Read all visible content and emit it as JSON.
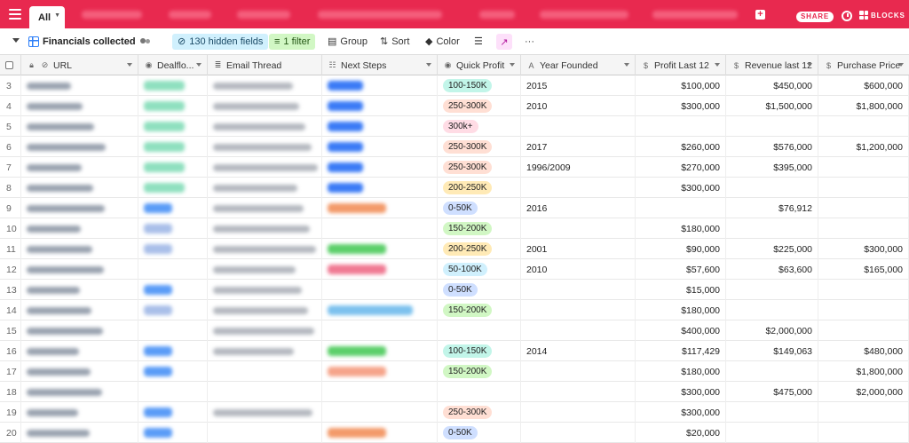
{
  "app": {
    "view_tab": "All",
    "share": "SHARE",
    "blocks": "BLOCKS"
  },
  "toolbar": {
    "view_name": "Financials collected",
    "hidden_fields": "130 hidden fields",
    "filter": "1 filter",
    "group": "Group",
    "sort": "Sort",
    "color": "Color",
    "more": "···"
  },
  "columns": [
    "URL",
    "Dealflo...",
    "Email Thread",
    "Next Steps",
    "Quick Profit",
    "Year Founded",
    "Profit Last 12",
    "Revenue last 12",
    "Purchase Price"
  ],
  "colors": {
    "brand": "#e8294f",
    "accent": "#2d7ff9"
  },
  "rows": [
    {
      "n": "3",
      "quick": "100-150K",
      "qc": "#c2f5e9",
      "year": "2015",
      "profit": "$100,000",
      "revenue": "$450,000",
      "price": "$600,000"
    },
    {
      "n": "4",
      "quick": "250-300K",
      "qc": "#ffdfd4",
      "year": "2010",
      "profit": "$300,000",
      "revenue": "$1,500,000",
      "price": "$1,800,000"
    },
    {
      "n": "5",
      "quick": "300k+",
      "qc": "#ffdce5",
      "year": "",
      "profit": "",
      "revenue": "",
      "price": ""
    },
    {
      "n": "6",
      "quick": "250-300K",
      "qc": "#ffdfd4",
      "year": "2017",
      "profit": "$260,000",
      "revenue": "$576,000",
      "price": "$1,200,000"
    },
    {
      "n": "7",
      "quick": "250-300K",
      "qc": "#ffdfd4",
      "year": "1996/2009",
      "profit": "$270,000",
      "revenue": "$395,000",
      "price": ""
    },
    {
      "n": "8",
      "quick": "200-250K",
      "qc": "#ffeab6",
      "year": "",
      "profit": "$300,000",
      "revenue": "",
      "price": ""
    },
    {
      "n": "9",
      "quick": "0-50K",
      "qc": "#cfdfff",
      "year": "2016",
      "profit": "",
      "revenue": "$76,912",
      "price": ""
    },
    {
      "n": "10",
      "quick": "150-200K",
      "qc": "#d1f7c4",
      "year": "",
      "profit": "$180,000",
      "revenue": "",
      "price": ""
    },
    {
      "n": "11",
      "quick": "200-250K",
      "qc": "#ffeab6",
      "year": "2001",
      "profit": "$90,000",
      "revenue": "$225,000",
      "price": "$300,000"
    },
    {
      "n": "12",
      "quick": "50-100K",
      "qc": "#d0f0fd",
      "year": "2010",
      "profit": "$57,600",
      "revenue": "$63,600",
      "price": "$165,000"
    },
    {
      "n": "13",
      "quick": "0-50K",
      "qc": "#cfdfff",
      "year": "",
      "profit": "$15,000",
      "revenue": "",
      "price": ""
    },
    {
      "n": "14",
      "quick": "150-200K",
      "qc": "#d1f7c4",
      "year": "",
      "profit": "$180,000",
      "revenue": "",
      "price": ""
    },
    {
      "n": "15",
      "quick": "",
      "qc": "",
      "year": "",
      "profit": "$400,000",
      "revenue": "$2,000,000",
      "price": ""
    },
    {
      "n": "16",
      "quick": "100-150K",
      "qc": "#c2f5e9",
      "year": "2014",
      "profit": "$117,429",
      "revenue": "$149,063",
      "price": "$480,000"
    },
    {
      "n": "17",
      "quick": "150-200K",
      "qc": "#d1f7c4",
      "year": "",
      "profit": "$180,000",
      "revenue": "",
      "price": "$1,800,000"
    },
    {
      "n": "18",
      "quick": "",
      "qc": "",
      "year": "",
      "profit": "$300,000",
      "revenue": "$475,000",
      "price": "$2,000,000"
    },
    {
      "n": "19",
      "quick": "250-300K",
      "qc": "#ffdfd4",
      "year": "",
      "profit": "$300,000",
      "revenue": "",
      "price": ""
    },
    {
      "n": "20",
      "quick": "0-50K",
      "qc": "#cfdfff",
      "year": "",
      "profit": "$20,000",
      "revenue": "",
      "price": ""
    }
  ]
}
